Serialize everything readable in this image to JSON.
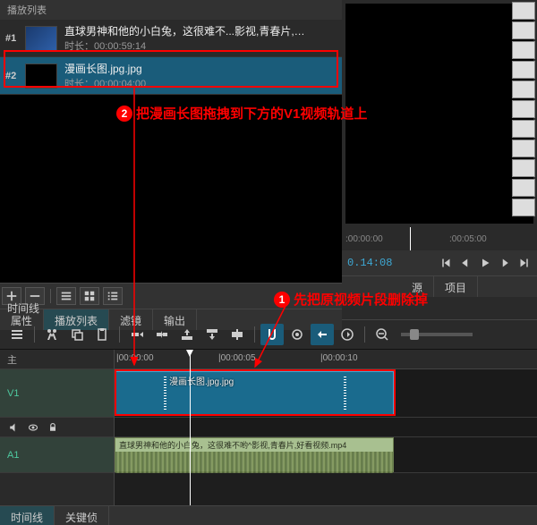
{
  "playlist": {
    "header": "播放列表",
    "items": [
      {
        "num": "#1",
        "title": "直球男神和他的小白兔，这很难不...影视,青春片,好看视频.mp4",
        "duration": "时长：00:00:59:14"
      },
      {
        "num": "#2",
        "title": "漫画长图.jpg.jpg",
        "duration": "时长：00:00:04:00"
      }
    ]
  },
  "tabs_upper": {
    "t1": "属性",
    "t2": "播放列表",
    "t3": "滤镜",
    "t4": "输出"
  },
  "tabs_preview": {
    "t1": "源",
    "t2": "项目"
  },
  "timeline_label": "时间线",
  "ruler": {
    "t0": "|00:00:00",
    "t1": "|00:00:05",
    "t2": "|00:00:10"
  },
  "preview_ruler": {
    "t0": ":00:00:00",
    "t1": ":00:05:00"
  },
  "timecode": "0.14:08",
  "tracks": {
    "main": "主",
    "v1": "V1",
    "a1": "A1"
  },
  "clip": {
    "label": "漫画长图.jpg.jpg"
  },
  "aclip": {
    "title": "直球男神和他的小白兔，这很难不哟^影视,青春片,好看视频.mp4"
  },
  "bottom_tabs": {
    "t1": "时间线",
    "t2": "关键侦"
  },
  "annotations": {
    "a1": "先把原视频片段删除掉",
    "a2": "把漫画长图拖拽到下方的V1视频轨道上"
  }
}
